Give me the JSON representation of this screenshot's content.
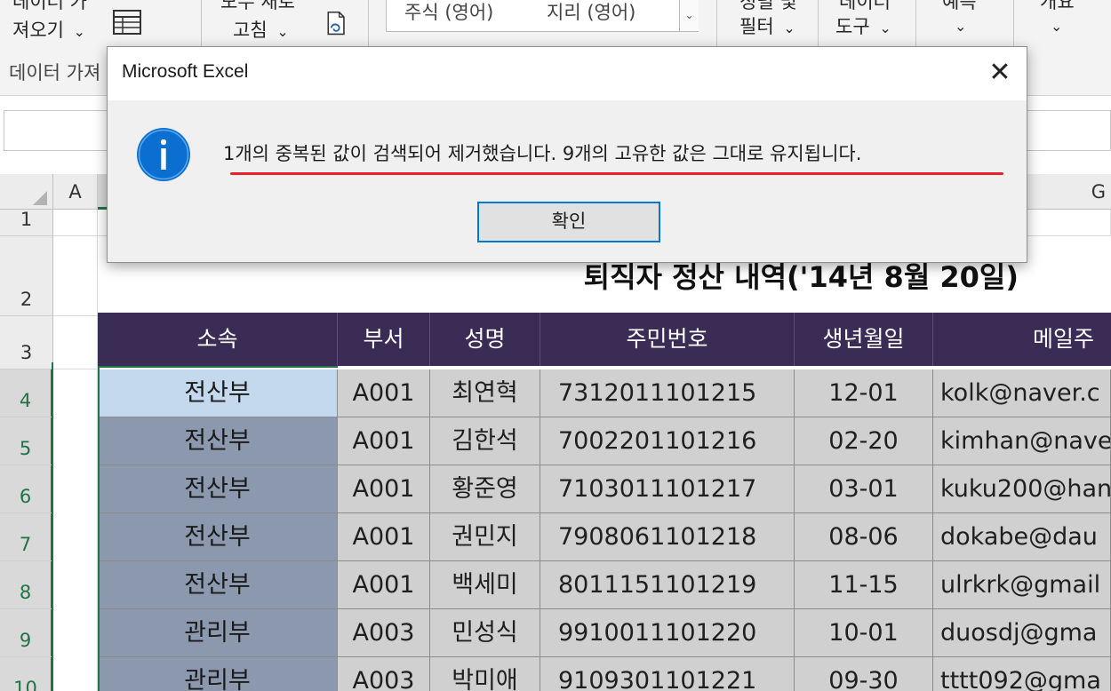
{
  "ribbon": {
    "get_data_line1": "데이터 가",
    "get_data_line2": "져오기",
    "group_label": "데이터 가져",
    "refresh_line1": "모두 새로",
    "refresh_line2": "고침",
    "style_stock": "주식 (영어)",
    "style_geo": "지리 (영어)",
    "sort_line1": "정렬 및",
    "sort_line2": "필터",
    "tools_line1": "데이터",
    "tools_line2": "도구",
    "forecast_label": "예측",
    "outline_label": "개요",
    "dropdown_glyph": "⌄"
  },
  "sheet": {
    "columns": [
      "A",
      "G"
    ],
    "rows": [
      "1",
      "2",
      "3",
      "4",
      "5",
      "6",
      "7",
      "8",
      "9",
      "10"
    ],
    "title": "퇴직자 정산 내역('14년 8월 20일)",
    "headers": [
      "소속",
      "부서",
      "성명",
      "주민번호",
      "생년월일",
      "메일주"
    ],
    "data": [
      [
        "전산부",
        "A001",
        "최연혁",
        "7312011101215",
        "12-01",
        "kolk@naver.c"
      ],
      [
        "전산부",
        "A001",
        "김한석",
        "7002201101216",
        "02-20",
        "kimhan@nave"
      ],
      [
        "전산부",
        "A001",
        "황준영",
        "7103011101217",
        "03-01",
        "kuku200@han"
      ],
      [
        "전산부",
        "A001",
        "권민지",
        "7908061101218",
        "08-06",
        "dokabe@dau"
      ],
      [
        "전산부",
        "A001",
        "백세미",
        "8011151101219",
        "11-15",
        "ulrkrk@gmail"
      ],
      [
        "관리부",
        "A003",
        "민성식",
        "9910011101220",
        "10-01",
        "duosdj@gma"
      ],
      [
        "관리부",
        "A003",
        "박미애",
        "9109301101221",
        "09-30",
        "tttt092@gma"
      ]
    ]
  },
  "dialog": {
    "title": "Microsoft Excel",
    "close_glyph": "✕",
    "icon": "info-icon",
    "message": "1개의 중복된 값이 검색되어 제거했습니다. 9개의 고유한 값은 그대로 유지됩니다.",
    "ok_label": "확인"
  },
  "colors": {
    "header_bg": "#3b2c56",
    "dept_bg": "#8b98ad",
    "active_cell": "#c4d8ee",
    "selection": "#217346",
    "info_blue": "#0a6fd0",
    "underline_red": "#e8202a"
  }
}
